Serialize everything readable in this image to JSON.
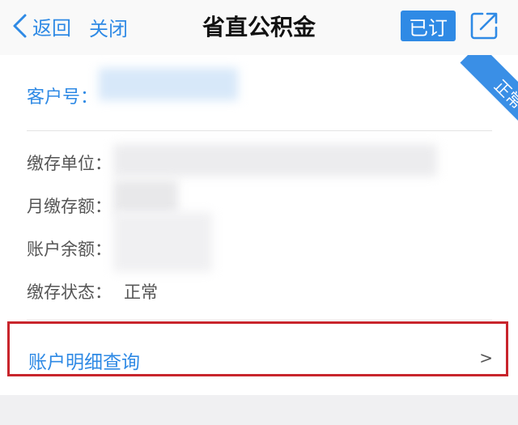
{
  "nav": {
    "back_label": "返回",
    "close_label": "关闭",
    "title": "省直公积金",
    "subscribed_label": "已订",
    "accent_color": "#2f8ae5"
  },
  "card": {
    "customer_label": "客户号：",
    "corner_status": "正常",
    "fields": [
      {
        "label": "缴存单位：",
        "value": ""
      },
      {
        "label": "月缴存额：",
        "value": ""
      },
      {
        "label": "账户余额：",
        "value": ""
      },
      {
        "label": "缴存状态：",
        "value": "正常"
      }
    ],
    "detail_link": {
      "label": "账户明细查询",
      "chevron": ">"
    }
  }
}
